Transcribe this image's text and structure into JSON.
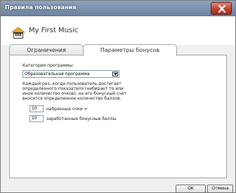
{
  "window": {
    "title": "Правила пользования"
  },
  "header": {
    "app_name": "My First Music",
    "logo_icon": "piano-house-icon"
  },
  "tabs": [
    {
      "label": "Ограничения",
      "active": false
    },
    {
      "label": "Параметры бонусов",
      "active": true
    }
  ],
  "bonus": {
    "category_label": "Категория программы:",
    "category_value": "Образовательная программа",
    "description": "Каждый раз, когда пользователь достигает определенного показателя (набирает то или иное количество очков), на его бонусный счет вносится определенное количество баллов.",
    "points": {
      "value": "10",
      "label": "набранные очки ="
    },
    "bonus_points": {
      "value": "10",
      "label": "заработанные бонусные баллы"
    }
  },
  "buttons": {
    "ok": "OK",
    "cancel": "Отмена"
  },
  "colors": {
    "close_button": "#c2402c",
    "title_bar": "#7a8fab",
    "logo_roof": "#e8a820"
  }
}
